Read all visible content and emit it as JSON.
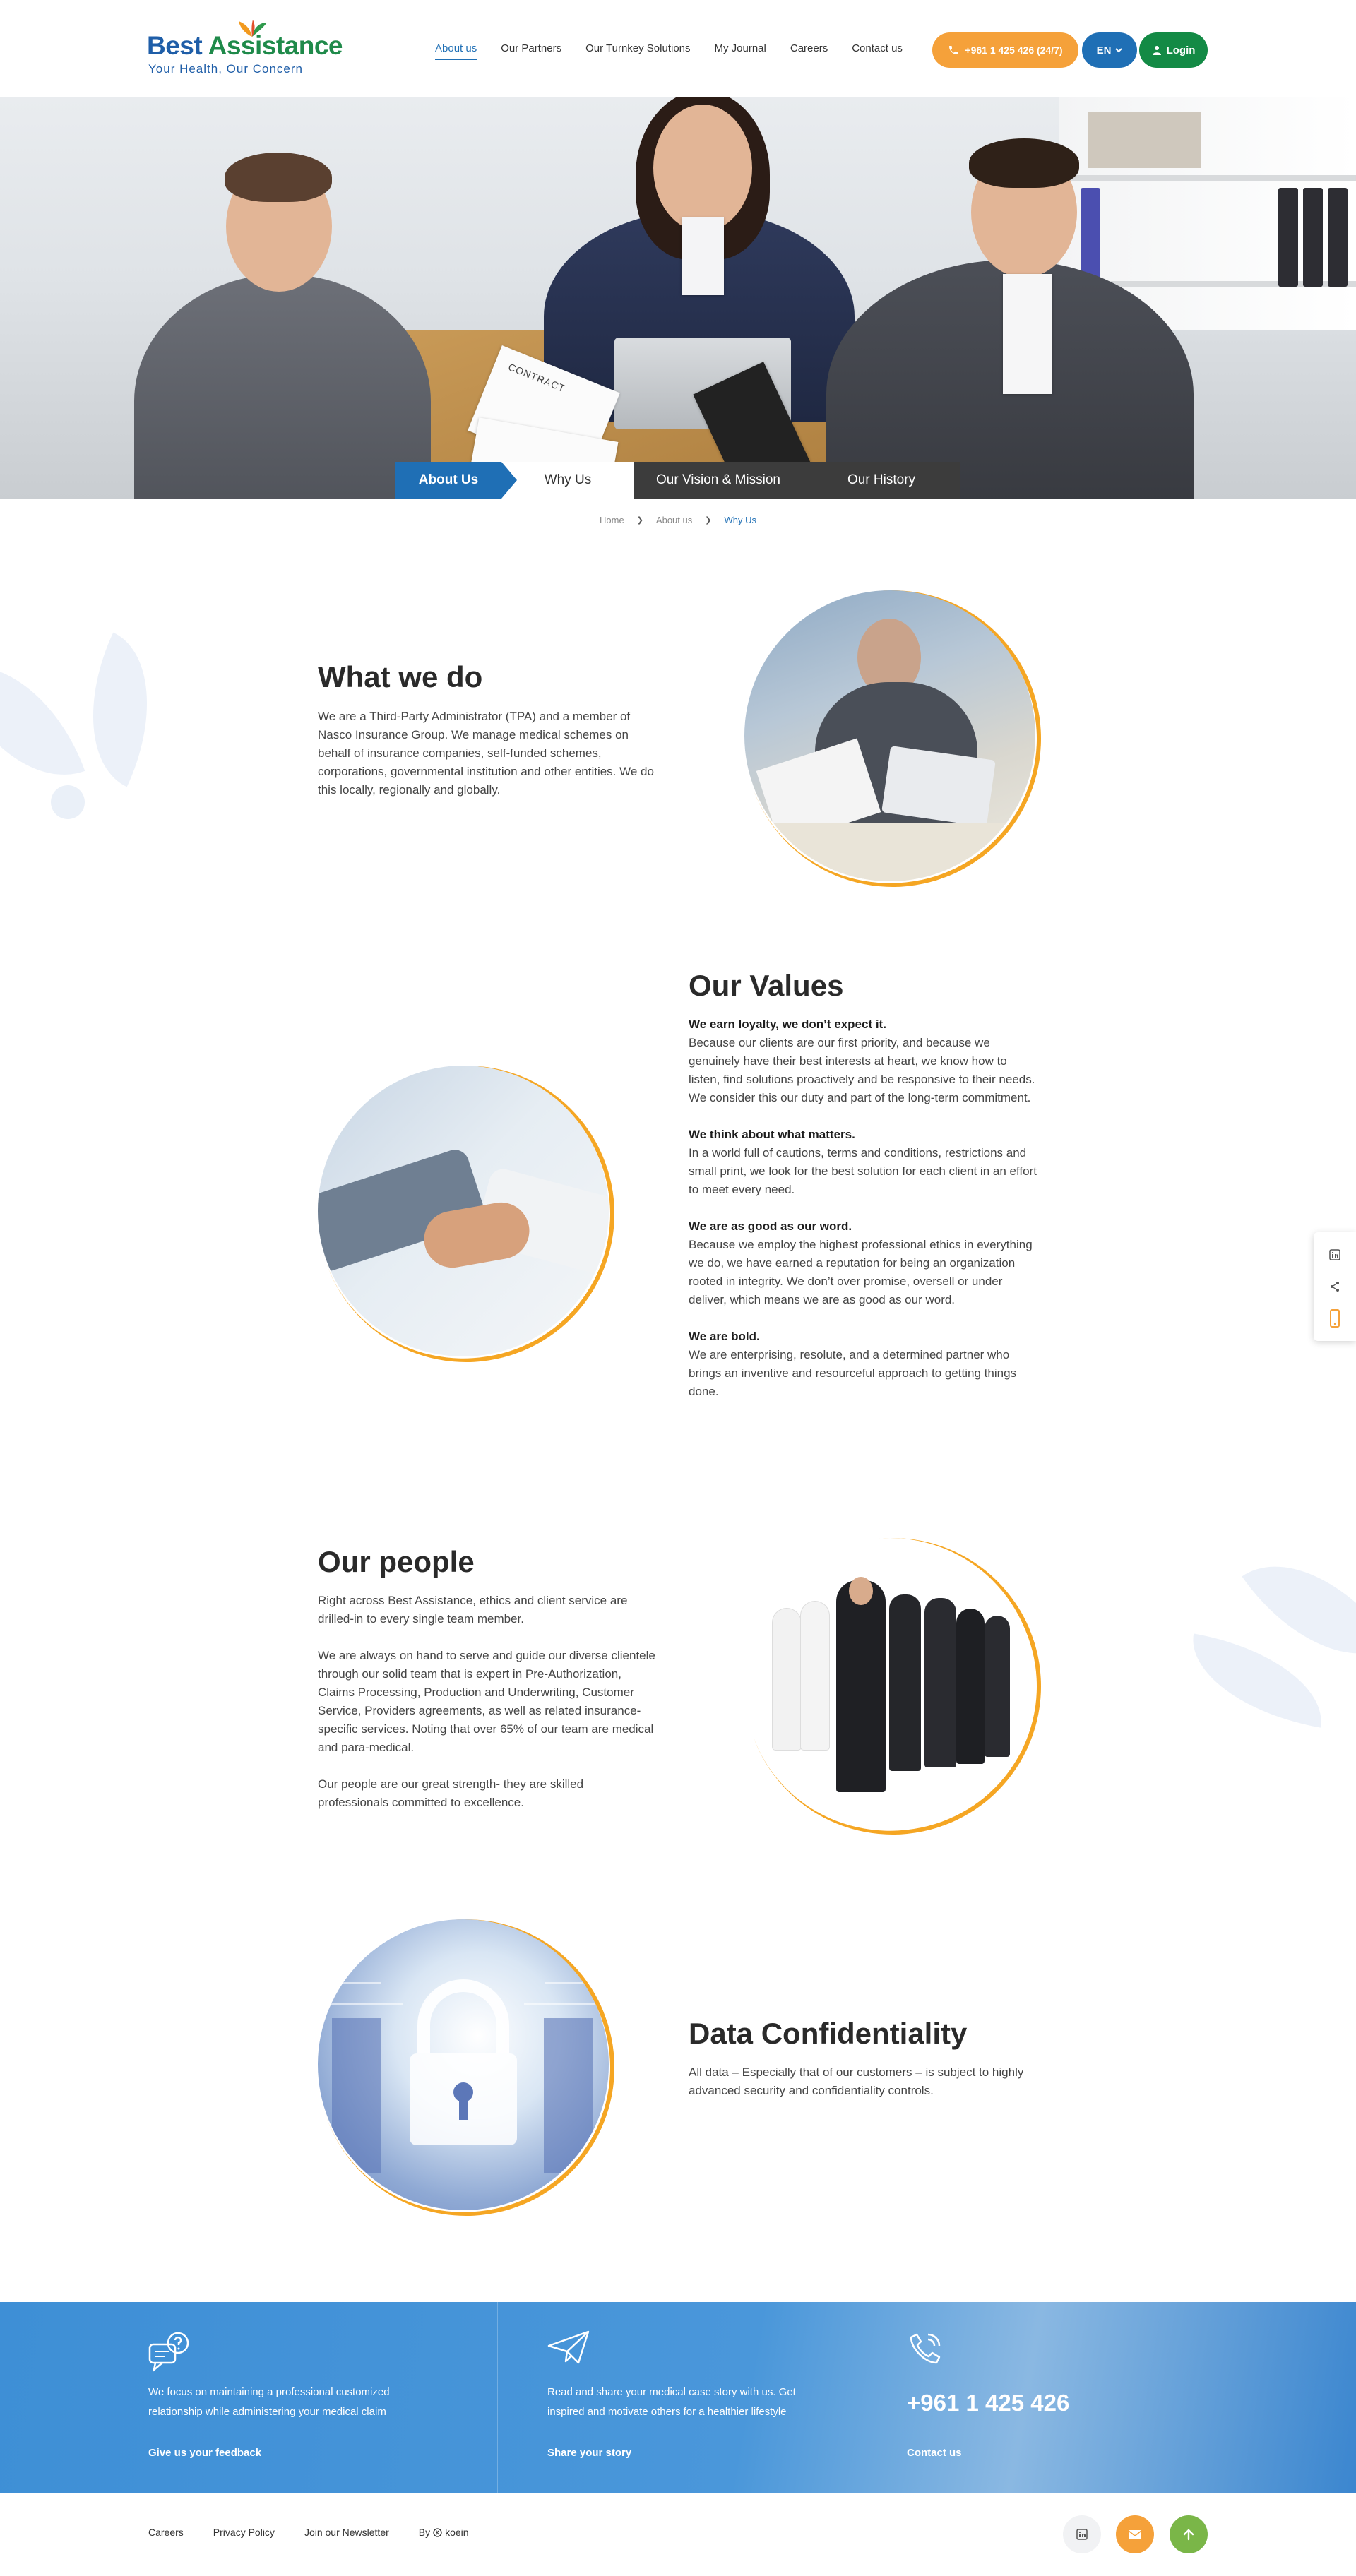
{
  "header": {
    "logo_name_1": "Best",
    "logo_name_2": "Assistance",
    "logo_tagline": "Your Health, Our Concern",
    "nav": [
      {
        "label": "About us"
      },
      {
        "label": "Our Partners"
      },
      {
        "label": "Our Turnkey Solutions"
      },
      {
        "label": "My Journal"
      },
      {
        "label": "Careers"
      },
      {
        "label": "Contact us"
      }
    ],
    "phone": "+961 1 425 426 (24/7)",
    "language": "EN",
    "login": "Login"
  },
  "hero": {
    "paper_text": "CONTRACT",
    "tabs": [
      {
        "label": "About Us"
      },
      {
        "label": "Why Us"
      },
      {
        "label": "Our Vision & Mission"
      },
      {
        "label": "Our History"
      }
    ]
  },
  "breadcrumb": {
    "home": "Home",
    "parent": "About us",
    "current": "Why Us"
  },
  "sections": {
    "what_we_do": {
      "title": "What we do",
      "text": "We are a Third-Party Administrator (TPA) and a member of Nasco Insurance Group. We manage medical schemes on behalf of insurance companies, self-funded schemes, corporations, governmental institution and other entities. We do this locally, regionally and globally."
    },
    "values": {
      "title": "Our Values",
      "items": [
        {
          "heading": "We earn loyalty, we don’t expect it.",
          "text": "Because our clients are our first priority, and because we genuinely have their best interests at heart, we know how to listen, find solutions proactively and be responsive to their needs. We consider this our duty and part of the long-term commitment."
        },
        {
          "heading": "We think about what matters.",
          "text": "In a world full of cautions, terms and conditions, restrictions and small print, we look for the best solution for each client in an effort to meet every need."
        },
        {
          "heading": "We are as good as our word.",
          "text": "Because we employ the highest professional ethics in everything we do, we have earned a reputation for being an organization rooted in integrity. We don’t over promise, oversell or under deliver, which means we are as good as our word."
        },
        {
          "heading": "We are bold.",
          "text": "We are enterprising, resolute, and a determined partner who brings an inventive and resourceful approach to getting things done."
        }
      ]
    },
    "people": {
      "title": "Our people",
      "paragraphs": [
        "Right across Best Assistance, ethics and client service are drilled-in to every single team member.",
        "We are always on hand to serve and guide our diverse clientele through our solid team that is expert in Pre-Authorization, Claims Processing, Production and Underwriting, Customer Service, Providers agreements, as well as related insurance-specific services. Noting that over 65% of our team are medical and para-medical.",
        "Our people are our great strength- they are skilled professionals committed to excellence."
      ]
    },
    "data": {
      "title": "Data Confidentiality",
      "text": "All data – Especially that of our customers – is subject to highly advanced security and confidentiality controls."
    }
  },
  "side_float": {
    "icons": [
      "linkedin-icon",
      "share-icon",
      "mobile-icon"
    ]
  },
  "cta": {
    "feedback_text": "We focus on maintaining a professional customized relationship while administering your medical claim",
    "feedback_link": "Give us your feedback",
    "story_text": "Read and share your medical case story with us. Get inspired and motivate others for a healthier lifestyle",
    "story_link": "Share your story",
    "phone": "+961 1 425 426",
    "contact_link": "Contact us"
  },
  "footer": {
    "links": [
      "Careers",
      "Privacy Policy",
      "Join our Newsletter"
    ],
    "credit_prefix": "By",
    "credit_name": "koein"
  },
  "colors": {
    "primary_blue": "#1f6fb5",
    "accent_orange": "#f5a13a",
    "brand_green": "#138a45",
    "dark_tab": "#3c3c3c"
  }
}
